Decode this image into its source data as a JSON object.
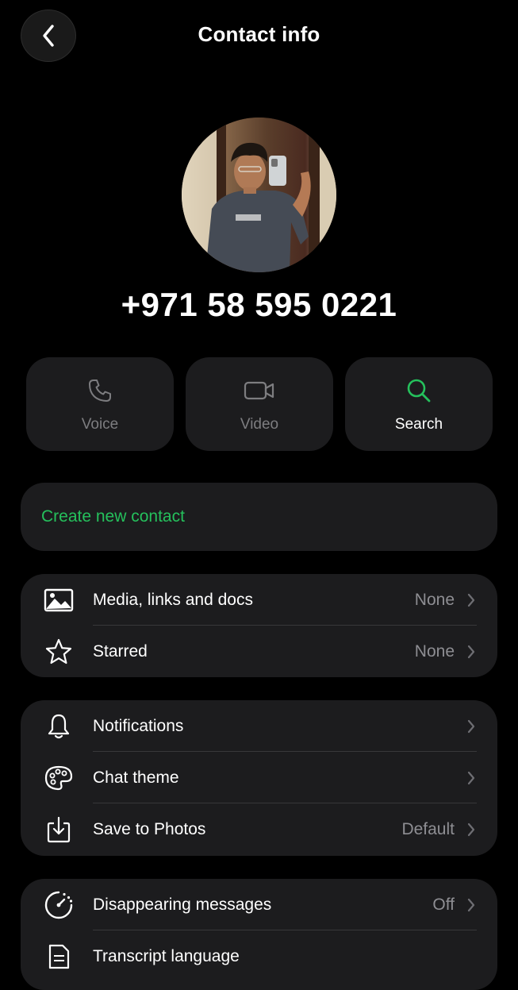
{
  "header": {
    "title": "Contact info",
    "back_icon": "chevron-left-icon"
  },
  "contact": {
    "phone": "+971 58 595 0221",
    "avatar": "profile-photo"
  },
  "actions": [
    {
      "label": "Voice",
      "icon": "phone-icon",
      "enabled": false
    },
    {
      "label": "Video",
      "icon": "video-camera-icon",
      "enabled": false
    },
    {
      "label": "Search",
      "icon": "search-icon",
      "enabled": true
    }
  ],
  "create_contact": {
    "label": "Create new contact"
  },
  "media_section": [
    {
      "label": "Media, links and docs",
      "value": "None",
      "icon": "image-icon"
    },
    {
      "label": "Starred",
      "value": "None",
      "icon": "star-icon"
    }
  ],
  "settings_section": [
    {
      "label": "Notifications",
      "value": "",
      "icon": "bell-icon"
    },
    {
      "label": "Chat theme",
      "value": "",
      "icon": "palette-icon"
    },
    {
      "label": "Save to Photos",
      "value": "Default",
      "icon": "download-icon"
    }
  ],
  "privacy_section": [
    {
      "label": "Disappearing messages",
      "value": "Off",
      "icon": "timer-icon"
    },
    {
      "label": "Transcript language",
      "value": "",
      "icon": "transcript-icon"
    }
  ],
  "colors": {
    "background": "#000000",
    "card": "#1c1c1e",
    "accent_green": "#25c05c",
    "secondary_text": "#8e8e93",
    "disabled_icon": "#7d7d80",
    "divider": "#38383a"
  }
}
